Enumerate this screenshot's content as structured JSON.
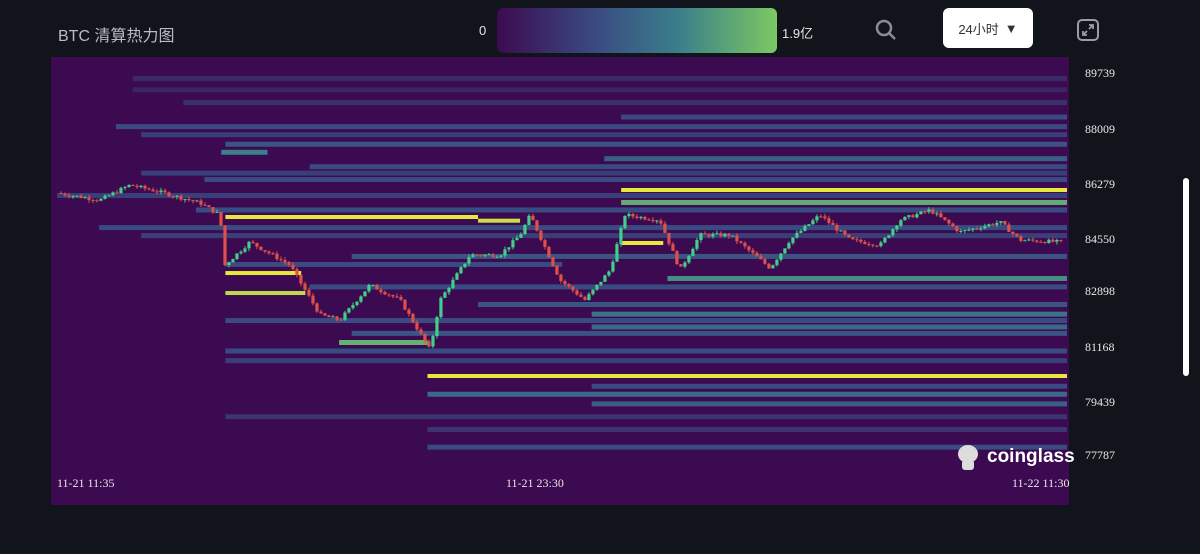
{
  "header": {
    "title": "BTC 清算热力图",
    "colorbar_min": "0",
    "colorbar_max": "1.9亿",
    "timeframe": "24小时"
  },
  "logo_text": "coinglass",
  "colors": {
    "bg": "#3c0a50",
    "up": "#3fd08a",
    "down": "#e0504a"
  },
  "chart_data": {
    "type": "heatmap",
    "title": "BTC 清算热力图",
    "ylim": [
      77787,
      89739
    ],
    "y_ticks": [
      "89739",
      "88009",
      "86279",
      "84550",
      "82898",
      "81168",
      "79439",
      "77787"
    ],
    "x_ticks": [
      "11-21 11:35",
      "11-21 23:30",
      "11-22 11:30"
    ],
    "x_range_hours": [
      0,
      24
    ],
    "price_path": [
      [
        0,
        85964
      ],
      [
        1.02,
        85745
      ],
      [
        1.73,
        86213
      ],
      [
        2.45,
        85995
      ],
      [
        3.4,
        85652
      ],
      [
        3.87,
        85277
      ],
      [
        3.99,
        83717
      ],
      [
        4.58,
        84435
      ],
      [
        5.53,
        83717
      ],
      [
        6.25,
        82157
      ],
      [
        6.72,
        82001
      ],
      [
        7.43,
        83093
      ],
      [
        8.15,
        82625
      ],
      [
        8.86,
        81065
      ],
      [
        9.1,
        82625
      ],
      [
        9.81,
        84029
      ],
      [
        10.52,
        84029
      ],
      [
        11.0,
        84653
      ],
      [
        11.24,
        85277
      ],
      [
        11.95,
        83249
      ],
      [
        12.54,
        82625
      ],
      [
        13.14,
        83561
      ],
      [
        13.49,
        85277
      ],
      [
        14.32,
        85121
      ],
      [
        14.8,
        83561
      ],
      [
        15.27,
        84653
      ],
      [
        15.99,
        84653
      ],
      [
        16.94,
        83624
      ],
      [
        17.41,
        84497
      ],
      [
        18.12,
        85277
      ],
      [
        18.84,
        84497
      ],
      [
        19.55,
        84341
      ],
      [
        20.02,
        85121
      ],
      [
        20.74,
        85433
      ],
      [
        21.45,
        84747
      ],
      [
        22.4,
        85059
      ],
      [
        22.87,
        84497
      ],
      [
        23.82,
        84435
      ]
    ],
    "bands": [
      [
        89550,
        1.8,
        24,
        0.15
      ],
      [
        89200,
        1.8,
        24,
        0.12
      ],
      [
        88800,
        3,
        24,
        0.18
      ],
      [
        88350,
        13.4,
        24,
        0.3
      ],
      [
        88050,
        1.4,
        24,
        0.3
      ],
      [
        87800,
        2,
        24,
        0.25
      ],
      [
        87500,
        4,
        24,
        0.35
      ],
      [
        87250,
        3.9,
        5,
        0.55
      ],
      [
        87050,
        13,
        24,
        0.4
      ],
      [
        86800,
        6,
        24,
        0.3
      ],
      [
        86600,
        2,
        24,
        0.25
      ],
      [
        86400,
        3.5,
        24,
        0.3
      ],
      [
        86057,
        13.4,
        24,
        1.0
      ],
      [
        85900,
        0,
        24,
        0.25
      ],
      [
        85684,
        13.4,
        24,
        0.7
      ],
      [
        85450,
        3.3,
        24,
        0.3
      ],
      [
        85215,
        4,
        10,
        1.0
      ],
      [
        85100,
        10,
        11,
        0.95
      ],
      [
        84900,
        1,
        24,
        0.3
      ],
      [
        84650,
        2,
        24,
        0.25
      ],
      [
        84404,
        13.4,
        14.4,
        1.0
      ],
      [
        84000,
        7,
        24,
        0.35
      ],
      [
        83750,
        4,
        12,
        0.3
      ],
      [
        83467,
        4,
        5.8,
        1.0
      ],
      [
        83312,
        14.5,
        24,
        0.6
      ],
      [
        83050,
        6,
        24,
        0.3
      ],
      [
        82843,
        4,
        5.9,
        0.92
      ],
      [
        82500,
        10,
        24,
        0.35
      ],
      [
        82200,
        12.7,
        24,
        0.5
      ],
      [
        82000,
        4,
        24,
        0.3
      ],
      [
        81800,
        12.7,
        24,
        0.45
      ],
      [
        81600,
        7,
        24,
        0.35
      ],
      [
        81315,
        6.7,
        8.8,
        0.72
      ],
      [
        81050,
        4,
        24,
        0.3
      ],
      [
        80750,
        4,
        24,
        0.25
      ],
      [
        80254,
        8.8,
        24,
        1.0
      ],
      [
        79950,
        12.7,
        24,
        0.3
      ],
      [
        79700,
        8.8,
        24,
        0.45
      ],
      [
        79400,
        12.7,
        24,
        0.4
      ],
      [
        79000,
        4,
        24,
        0.2
      ],
      [
        78600,
        8.8,
        24,
        0.2
      ],
      [
        78050,
        8.8,
        24,
        0.3
      ]
    ]
  }
}
